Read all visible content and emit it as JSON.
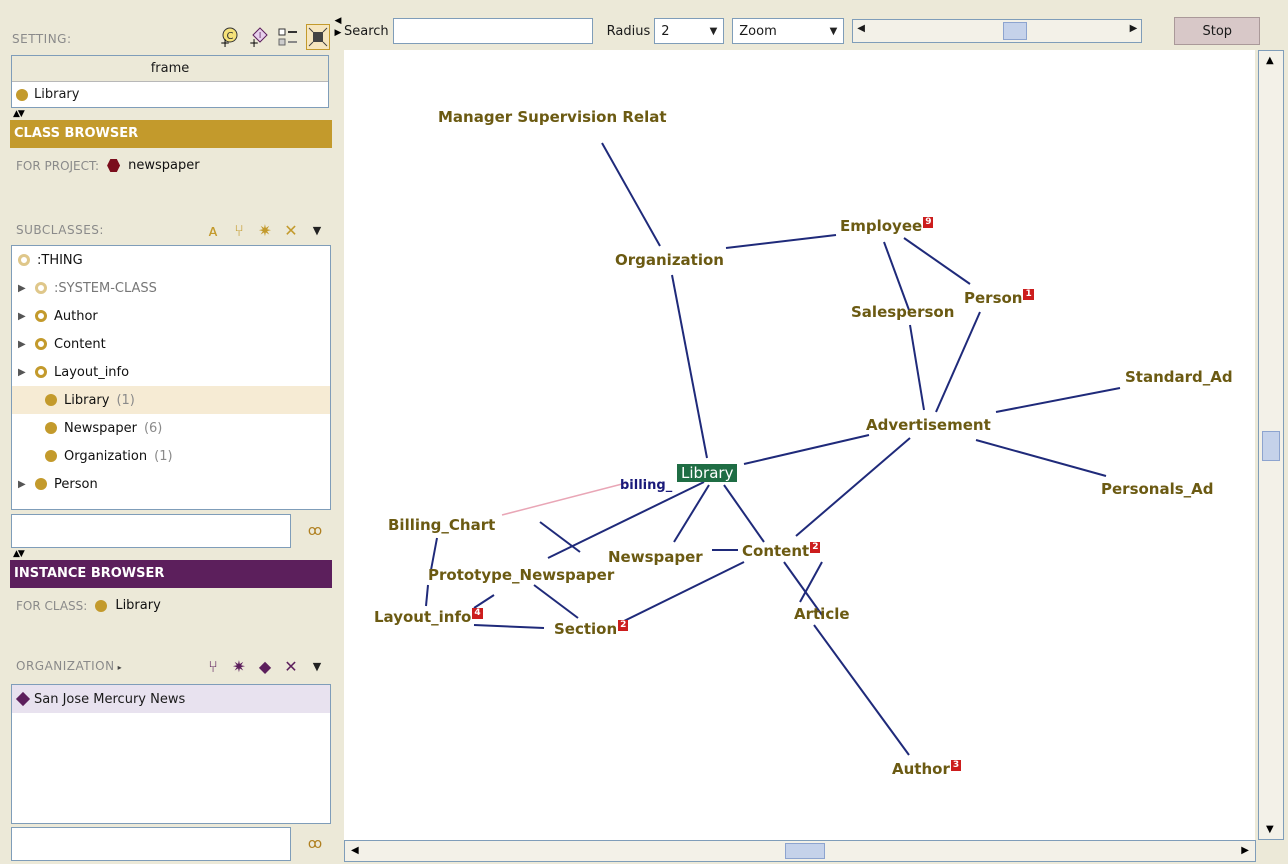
{
  "settings": {
    "label": "SETTING:",
    "icons": [
      "create-class-icon",
      "create-instance-icon",
      "checklist-icon",
      "collapse-icon"
    ],
    "frame_header": "frame",
    "frame_value": "Library"
  },
  "class_browser": {
    "title": "CLASS BROWSER",
    "for_project_label": "FOR PROJECT:",
    "project_name": "newspaper",
    "subclasses_label": "SUBCLASSES:",
    "tree": [
      {
        "label": ":THING",
        "count": "",
        "expandable": false,
        "dim": false,
        "icon": "ring"
      },
      {
        "label": ":SYSTEM-CLASS",
        "count": "",
        "expandable": true,
        "dim": true,
        "icon": "pale"
      },
      {
        "label": "Author",
        "count": "",
        "expandable": true,
        "dim": false,
        "icon": "ring"
      },
      {
        "label": "Content",
        "count": "",
        "expandable": true,
        "dim": false,
        "icon": "ring"
      },
      {
        "label": "Layout_info",
        "count": "",
        "expandable": true,
        "dim": false,
        "icon": "ring"
      },
      {
        "label": "Library",
        "count": "(1)",
        "expandable": false,
        "dim": false,
        "icon": "solid",
        "selected": true
      },
      {
        "label": "Newspaper",
        "count": "(6)",
        "expandable": false,
        "dim": false,
        "icon": "solid"
      },
      {
        "label": "Organization",
        "count": "(1)",
        "expandable": false,
        "dim": false,
        "icon": "solid"
      },
      {
        "label": "Person",
        "count": "",
        "expandable": true,
        "dim": false,
        "icon": "solid"
      }
    ]
  },
  "instance_browser": {
    "title": "INSTANCE BROWSER",
    "for_class_label": "FOR CLASS:",
    "class_name": "Library",
    "slot_label": "ORGANIZATION",
    "instances": [
      "San Jose Mercury News"
    ]
  },
  "toolbar": {
    "search_label": "Search",
    "search_value": "",
    "radius_label": "Radius",
    "radius_value": "2",
    "zoom_value": "Zoom",
    "stop_label": "Stop"
  },
  "graph": {
    "selected_node": "Library",
    "nodes": [
      {
        "id": "manager",
        "label": "Manager Supervision Relat",
        "badge": ""
      },
      {
        "id": "organization",
        "label": "Organization",
        "badge": ""
      },
      {
        "id": "employee",
        "label": "Employee",
        "badge": "9"
      },
      {
        "id": "person",
        "label": "Person",
        "badge": "1"
      },
      {
        "id": "salesperson",
        "label": "Salesperson",
        "badge": ""
      },
      {
        "id": "standard_ad",
        "label": "Standard_Ad",
        "badge": ""
      },
      {
        "id": "advertisement",
        "label": "Advertisement",
        "badge": ""
      },
      {
        "id": "personals_ad",
        "label": "Personals_Ad",
        "badge": ""
      },
      {
        "id": "library",
        "label": "Library",
        "badge": ""
      },
      {
        "id": "billing_chart",
        "label": "Billing_Chart",
        "badge": ""
      },
      {
        "id": "prototype_newspaper",
        "label": "Prototype_Newspaper",
        "badge": ""
      },
      {
        "id": "newspaper",
        "label": "Newspaper",
        "badge": ""
      },
      {
        "id": "content",
        "label": "Content",
        "badge": "2"
      },
      {
        "id": "layout_info",
        "label": "Layout_info",
        "badge": "4"
      },
      {
        "id": "section",
        "label": "Section",
        "badge": "2"
      },
      {
        "id": "article",
        "label": "Article",
        "badge": ""
      },
      {
        "id": "author",
        "label": "Author",
        "badge": "3"
      }
    ],
    "edge_label": "billing_"
  }
}
